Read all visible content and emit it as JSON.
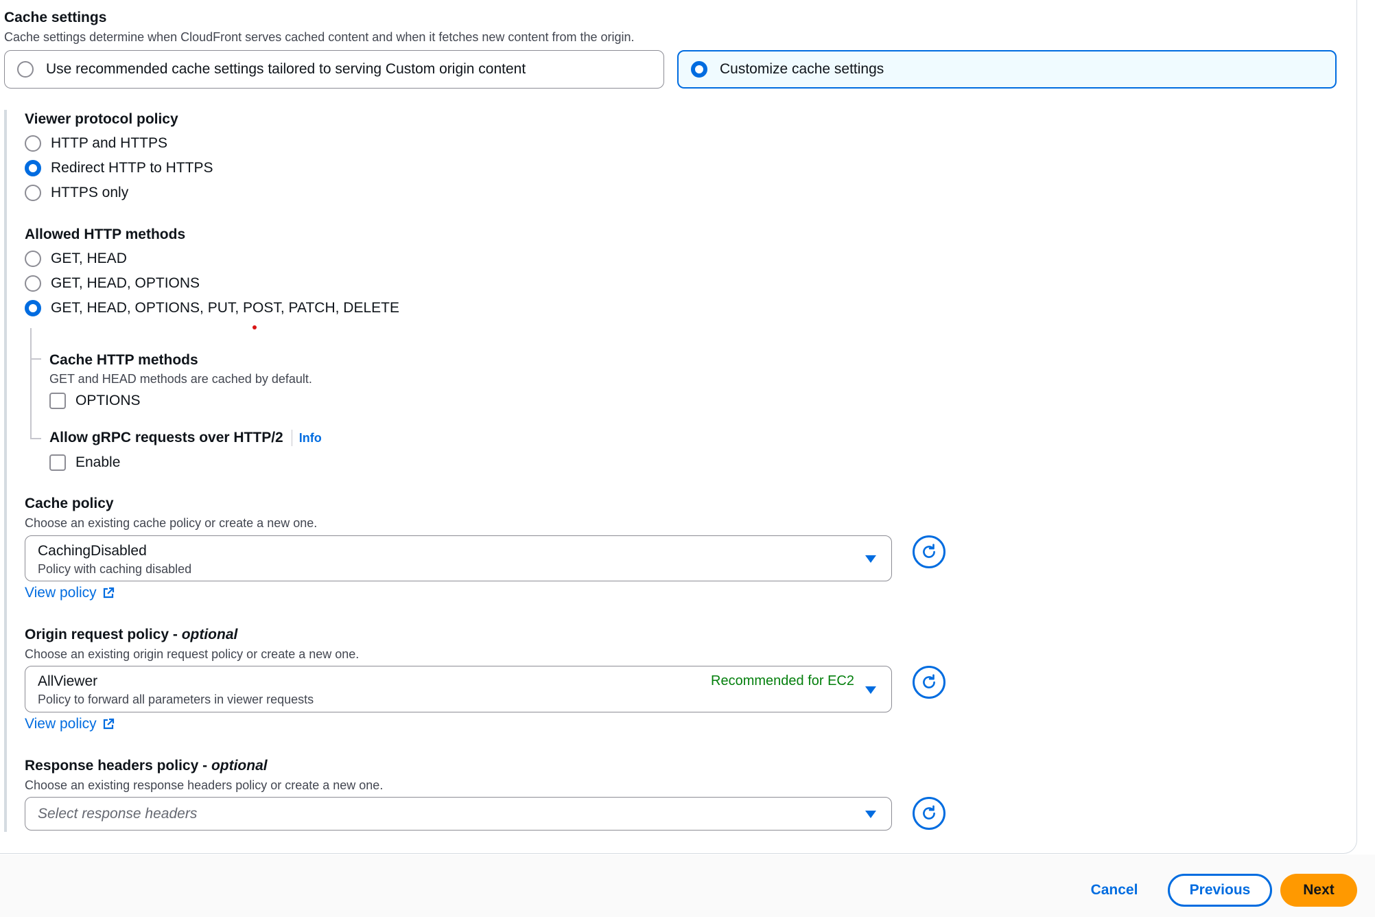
{
  "cache_settings": {
    "title": "Cache settings",
    "description": "Cache settings determine when CloudFront serves cached content and when it fetches new content from the origin.",
    "options": [
      {
        "label": "Use recommended cache settings tailored to serving Custom origin content",
        "selected": false
      },
      {
        "label": "Customize cache settings",
        "selected": true
      }
    ]
  },
  "viewer_protocol": {
    "title": "Viewer protocol policy",
    "options": [
      {
        "label": "HTTP and HTTPS",
        "selected": false
      },
      {
        "label": "Redirect HTTP to HTTPS",
        "selected": true
      },
      {
        "label": "HTTPS only",
        "selected": false
      }
    ]
  },
  "allowed_methods": {
    "title": "Allowed HTTP methods",
    "options": [
      {
        "label": "GET, HEAD",
        "selected": false
      },
      {
        "label": "GET, HEAD, OPTIONS",
        "selected": false
      },
      {
        "label": "GET, HEAD, OPTIONS, PUT, POST, PATCH, DELETE",
        "selected": true
      }
    ]
  },
  "cache_methods": {
    "title": "Cache HTTP methods",
    "description": "GET and HEAD methods are cached by default.",
    "checkbox_label": "OPTIONS",
    "checked": false
  },
  "grpc": {
    "title": "Allow gRPC requests over HTTP/2",
    "info_label": "Info",
    "checkbox_label": "Enable",
    "checked": false
  },
  "cache_policy": {
    "title": "Cache policy",
    "description": "Choose an existing cache policy or create a new one.",
    "selected_value": "CachingDisabled",
    "selected_sub": "Policy with caching disabled",
    "view_link": "View policy"
  },
  "origin_request_policy": {
    "title": "Origin request policy - ",
    "title_optional": "optional",
    "description": "Choose an existing origin request policy or create a new one.",
    "selected_value": "AllViewer",
    "selected_sub": "Policy to forward all parameters in viewer requests",
    "badge": "Recommended for EC2",
    "view_link": "View policy"
  },
  "response_headers_policy": {
    "title": "Response headers policy - ",
    "title_optional": "optional",
    "description": "Choose an existing response headers policy or create a new one.",
    "placeholder": "Select response headers"
  },
  "footer": {
    "cancel": "Cancel",
    "previous": "Previous",
    "next": "Next"
  },
  "colors": {
    "accent": "#006ce0",
    "primary_button": "#ff9900",
    "badge_text": "#037f0c"
  }
}
